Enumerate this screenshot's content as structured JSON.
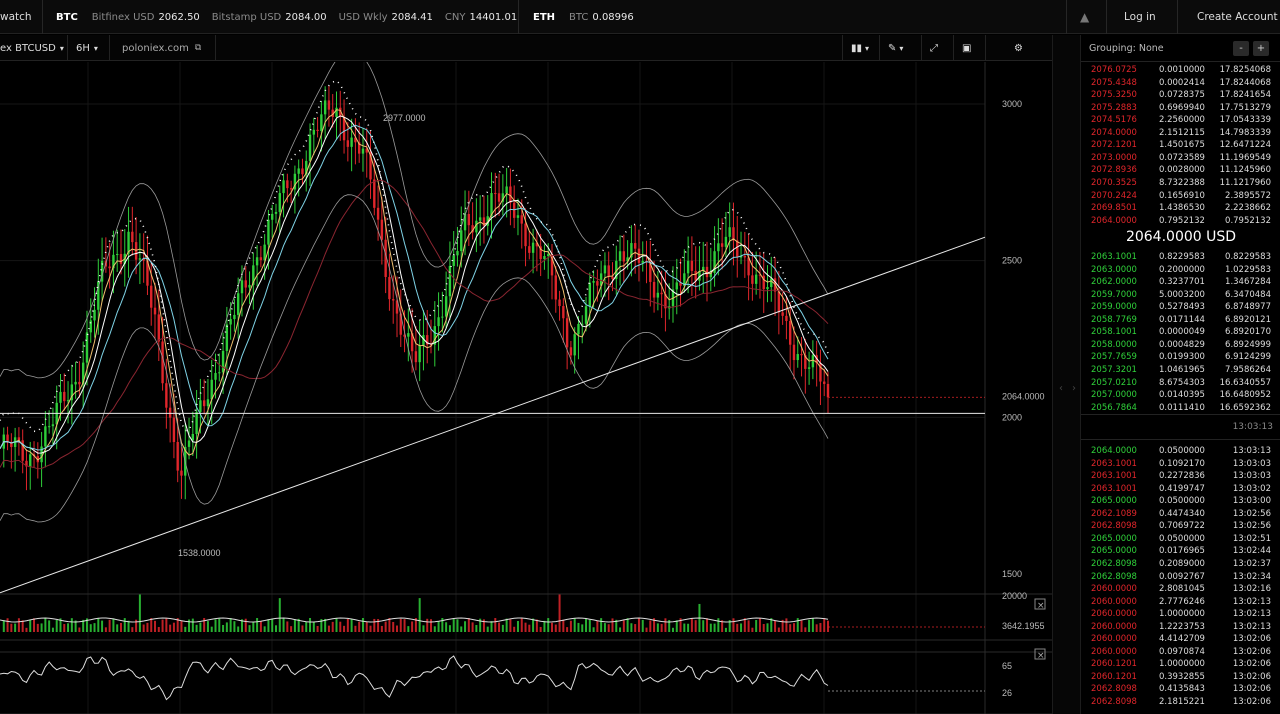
{
  "topbar": {
    "watch_label": "watch",
    "btc": {
      "label": "BTC",
      "items": [
        {
          "label": "Bitfinex USD",
          "value": "2062.50"
        },
        {
          "label": "Bitstamp USD",
          "value": "2084.00"
        },
        {
          "label": "USD Wkly",
          "value": "2084.41"
        },
        {
          "label": "CNY",
          "value": "14401.01"
        }
      ]
    },
    "eth": {
      "label": "ETH",
      "items": [
        {
          "label": "BTC",
          "value": "0.08996"
        }
      ]
    },
    "login": "Log in",
    "create_account": "Create Account"
  },
  "toolbar": {
    "symbol": "ex BTCUSD",
    "interval": "6H",
    "source": "poloniex.com"
  },
  "chart": {
    "price_axis": [
      "3000",
      "2500",
      "2000",
      "1500"
    ],
    "current_price_tag": "2064.0000",
    "high_label": "2977.0000",
    "low_label": "1538.0000",
    "volume_axis": [
      "20000",
      "3642.1955"
    ],
    "rsi_axis": [
      "65",
      "26"
    ]
  },
  "chart_data": {
    "type": "line",
    "title": "",
    "xlabel": "",
    "ylabel": "",
    "ylim": [
      1500,
      3000
    ],
    "series": [
      {
        "values": [
          1900,
          1880,
          1960,
          2150,
          2450,
          2600,
          2300,
          1800,
          2100,
          2300,
          2550,
          2700,
          2900,
          2977,
          2850,
          2450,
          2150,
          2350,
          2600,
          2700,
          2650,
          2500,
          2250,
          2400,
          2550,
          2450,
          2380,
          2480,
          2550,
          2500,
          2350,
          2200,
          2064
        ]
      }
    ],
    "grid": true,
    "annotations": [
      "2977.0000",
      "1538.0000",
      "2064.0000"
    ]
  },
  "orderbook": {
    "grouping": "Grouping: None",
    "asks": [
      {
        "p": "2076.0725",
        "a": "0.0010000",
        "t": "17.8254068"
      },
      {
        "p": "2075.4348",
        "a": "0.0002414",
        "t": "17.8244068"
      },
      {
        "p": "2075.3250",
        "a": "0.0728375",
        "t": "17.8241654"
      },
      {
        "p": "2075.2883",
        "a": "0.6969940",
        "t": "17.7513279"
      },
      {
        "p": "2074.5176",
        "a": "2.2560000",
        "t": "17.0543339"
      },
      {
        "p": "2074.0000",
        "a": "2.1512115",
        "t": "14.7983339"
      },
      {
        "p": "2072.1201",
        "a": "1.4501675",
        "t": "12.6471224"
      },
      {
        "p": "2073.0000",
        "a": "0.0723589",
        "t": "11.1969549"
      },
      {
        "p": "2072.8936",
        "a": "0.0028000",
        "t": "11.1245960"
      },
      {
        "p": "2070.3525",
        "a": "8.7322388",
        "t": "11.1217960"
      },
      {
        "p": "2070.2424",
        "a": "0.1656910",
        "t": "2.3895572"
      },
      {
        "p": "2069.8501",
        "a": "1.4386530",
        "t": "2.2238662"
      },
      {
        "p": "2064.0000",
        "a": "0.7952132",
        "t": "0.7952132"
      }
    ],
    "last_price": "2064.0000 USD",
    "bids": [
      {
        "p": "2063.1001",
        "a": "0.8229583",
        "t": "0.8229583"
      },
      {
        "p": "2063.0000",
        "a": "0.2000000",
        "t": "1.0229583"
      },
      {
        "p": "2062.0000",
        "a": "0.3237701",
        "t": "1.3467284"
      },
      {
        "p": "2059.7000",
        "a": "5.0003200",
        "t": "6.3470484"
      },
      {
        "p": "2059.0000",
        "a": "0.5278493",
        "t": "6.8748977"
      },
      {
        "p": "2058.7769",
        "a": "0.0171144",
        "t": "6.8920121"
      },
      {
        "p": "2058.1001",
        "a": "0.0000049",
        "t": "6.8920170"
      },
      {
        "p": "2058.0000",
        "a": "0.0004829",
        "t": "6.8924999"
      },
      {
        "p": "2057.7659",
        "a": "0.0199300",
        "t": "6.9124299"
      },
      {
        "p": "2057.3201",
        "a": "1.0461965",
        "t": "7.9586264"
      },
      {
        "p": "2057.0210",
        "a": "8.6754303",
        "t": "16.6340557"
      },
      {
        "p": "2057.0000",
        "a": "0.0140395",
        "t": "16.6480952"
      },
      {
        "p": "2056.7864",
        "a": "0.0111410",
        "t": "16.6592362"
      }
    ],
    "divider_time": "13:03:13",
    "trades": [
      {
        "p": "2064.0000",
        "a": "0.0500000",
        "t": "13:03:13",
        "c": "green"
      },
      {
        "p": "2063.1001",
        "a": "0.1092170",
        "t": "13:03:03",
        "c": "red"
      },
      {
        "p": "2063.1001",
        "a": "0.2272836",
        "t": "13:03:03",
        "c": "red"
      },
      {
        "p": "2063.1001",
        "a": "0.4199747",
        "t": "13:03:02",
        "c": "red"
      },
      {
        "p": "2065.0000",
        "a": "0.0500000",
        "t": "13:03:00",
        "c": "green"
      },
      {
        "p": "2062.1089",
        "a": "0.4474340",
        "t": "13:02:56",
        "c": "red"
      },
      {
        "p": "2062.8098",
        "a": "0.7069722",
        "t": "13:02:56",
        "c": "red"
      },
      {
        "p": "2065.0000",
        "a": "0.0500000",
        "t": "13:02:51",
        "c": "green"
      },
      {
        "p": "2065.0000",
        "a": "0.0176965",
        "t": "13:02:44",
        "c": "green"
      },
      {
        "p": "2062.8098",
        "a": "0.2089000",
        "t": "13:02:37",
        "c": "green"
      },
      {
        "p": "2062.8098",
        "a": "0.0092767",
        "t": "13:02:34",
        "c": "green"
      },
      {
        "p": "2060.0000",
        "a": "2.8081045",
        "t": "13:02:16",
        "c": "red"
      },
      {
        "p": "2060.0000",
        "a": "2.7776246",
        "t": "13:02:13",
        "c": "red"
      },
      {
        "p": "2060.0000",
        "a": "1.0000000",
        "t": "13:02:13",
        "c": "red"
      },
      {
        "p": "2060.0000",
        "a": "1.2223753",
        "t": "13:02:13",
        "c": "red"
      },
      {
        "p": "2060.0000",
        "a": "4.4142709",
        "t": "13:02:06",
        "c": "red"
      },
      {
        "p": "2060.0000",
        "a": "0.0970874",
        "t": "13:02:06",
        "c": "red"
      },
      {
        "p": "2060.1201",
        "a": "1.0000000",
        "t": "13:02:06",
        "c": "red"
      },
      {
        "p": "2060.1201",
        "a": "0.3932855",
        "t": "13:02:06",
        "c": "red"
      },
      {
        "p": "2062.8098",
        "a": "0.4135843",
        "t": "13:02:06",
        "c": "red"
      },
      {
        "p": "2062.8098",
        "a": "2.1815221",
        "t": "13:02:06",
        "c": "red"
      }
    ]
  },
  "colors": {
    "up": "#2fcf3a",
    "down": "#e0262b",
    "accent": "#ffffff"
  }
}
